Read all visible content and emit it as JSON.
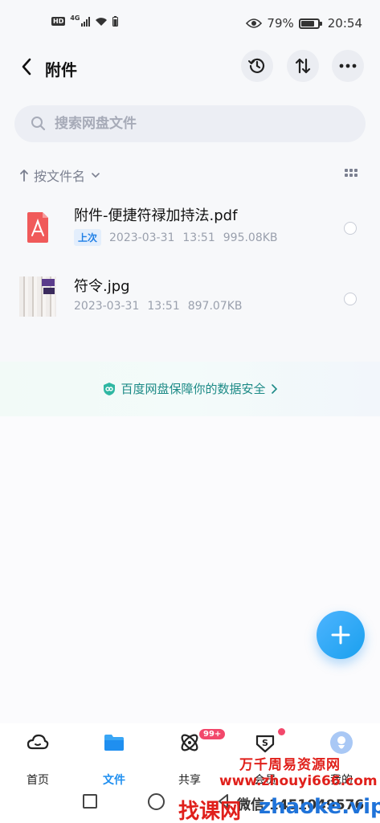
{
  "status_bar": {
    "hd_label": "HD",
    "net_label": "4G",
    "battery_pct": "79%",
    "time": "20:54"
  },
  "header": {
    "title": "附件",
    "icons": [
      "back-arrow-icon",
      "history-icon",
      "sort-arrows-icon",
      "more-dots-icon"
    ]
  },
  "search": {
    "placeholder": "搜索网盘文件"
  },
  "sort": {
    "label": "按文件名"
  },
  "files": [
    {
      "name": "附件-便捷符禄加持法.pdf",
      "badge": "上次",
      "date": "2023-03-31",
      "time": "13:51",
      "size": "995.08KB",
      "icon": "pdf-file-icon"
    },
    {
      "name": "符令.jpg",
      "date": "2023-03-31",
      "time": "13:51",
      "size": "897.07KB",
      "icon": "image-thumbnail"
    }
  ],
  "security": {
    "text": "百度网盘保障你的数据安全"
  },
  "tabs": [
    {
      "label": "首页",
      "icon": "cloud-icon"
    },
    {
      "label": "文件",
      "icon": "folder-icon",
      "active": true
    },
    {
      "label": "共享",
      "icon": "share-atom-icon",
      "badge": "99+"
    },
    {
      "label": "会员",
      "icon": "vip-diamond-icon"
    },
    {
      "label": "我的",
      "icon": "profile-avatar-icon"
    }
  ],
  "watermark": {
    "line1": "万千周易资源网",
    "line2": "www.zhouyi666.com",
    "line3": "微信 1451049576",
    "brand_red": "找课网",
    "brand_blue": "zhaoke.vip"
  },
  "colors": {
    "accent": "#1f8ff0",
    "security_green": "#1c8a86",
    "badge_red": "#f2486b",
    "pdf_red": "#f05a5a",
    "watermark_red": "#e0201b"
  }
}
